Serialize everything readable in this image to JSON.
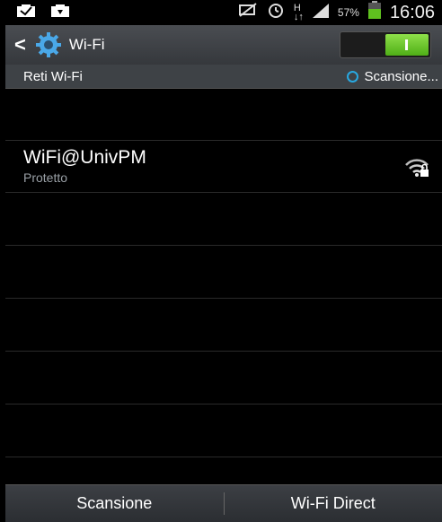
{
  "status_bar": {
    "left_icons": [
      "message-icon",
      "download-icon"
    ],
    "right_icons": [
      "muted-icon",
      "alarm-icon",
      "data-hplus-icon",
      "signal-icon"
    ],
    "battery": "57%",
    "time": "16:06"
  },
  "action_bar": {
    "back_icon": "back-chevron-icon",
    "app_icon": "gear-icon",
    "title": "Wi-Fi",
    "toggle_on": true
  },
  "section": {
    "label": "Reti Wi-Fi",
    "scan_status": "Scansione..."
  },
  "networks": [
    {
      "ssid": "WiFi@UnivPM",
      "status": "Protetto",
      "icon": "wifi-lock-icon"
    }
  ],
  "bottom_bar": {
    "scan_label": "Scansione",
    "direct_label": "Wi-Fi Direct"
  },
  "colors": {
    "toggle_accent": "#5fc11f",
    "spinner": "#28a8e0"
  }
}
